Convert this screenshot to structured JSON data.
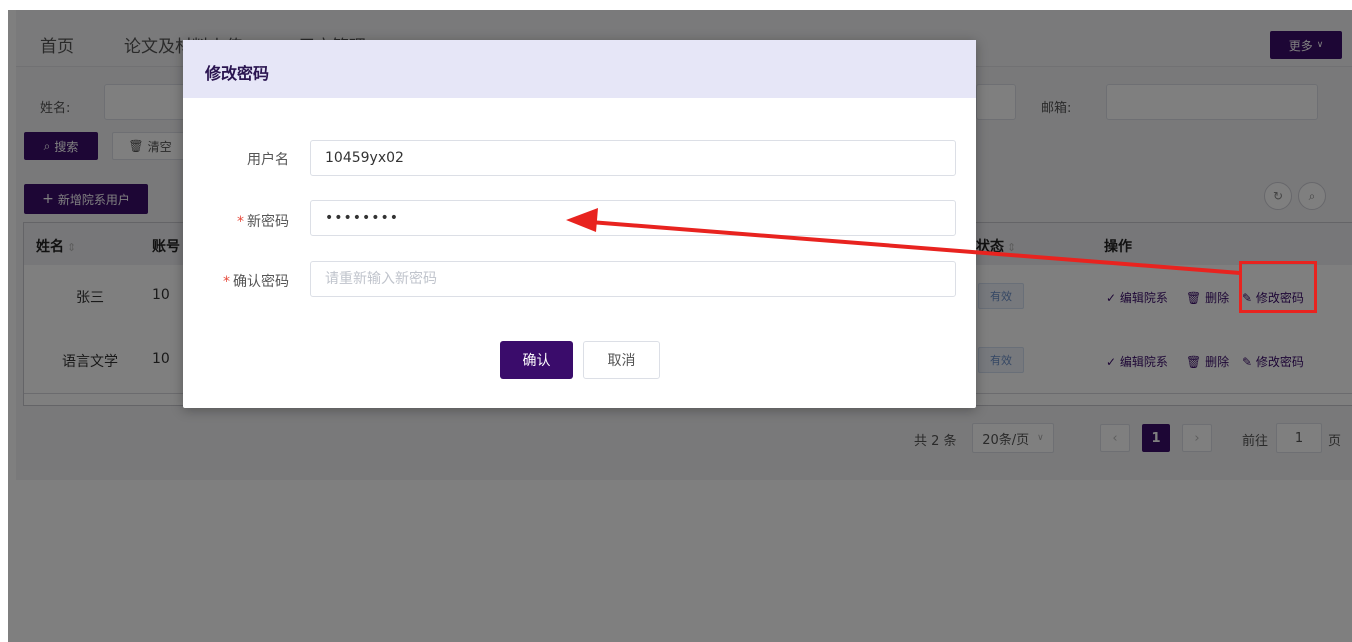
{
  "nav": {
    "items": [
      "首页",
      "论文及材料上传",
      "用户管理"
    ],
    "more_label": "更多"
  },
  "filters": {
    "name_label": "姓名:",
    "email_label": "邮箱:",
    "search_label": "搜索",
    "clear_label": "清空",
    "add_label": "新增院系用户"
  },
  "table": {
    "headers": {
      "name": "姓名",
      "account": "账号",
      "status": "状态",
      "ops": "操作"
    },
    "rows": [
      {
        "name": "张三",
        "account": "10",
        "status": "有效",
        "op_edit": "编辑院系",
        "op_delete": "删除",
        "op_pwd": "修改密码"
      },
      {
        "name": "语言文学",
        "account": "10",
        "status": "有效",
        "op_edit": "编辑院系",
        "op_delete": "删除",
        "op_pwd": "修改密码"
      }
    ]
  },
  "pagination": {
    "total": "共 2 条",
    "page_size": "20条/页",
    "current_page": "1",
    "goto_label": "前往",
    "goto_value": "1",
    "page_suffix": "页"
  },
  "dialog": {
    "title": "修改密码",
    "username_label": "用户名",
    "username_value": "10459yx02",
    "new_password_label": "新密码",
    "new_password_value": "12345678",
    "confirm_password_label": "确认密码",
    "confirm_password_placeholder": "请重新输入新密码",
    "confirm_label": "确认",
    "cancel_label": "取消"
  },
  "colors": {
    "primary": "#3a0c6b",
    "annotation": "#e8231f"
  }
}
